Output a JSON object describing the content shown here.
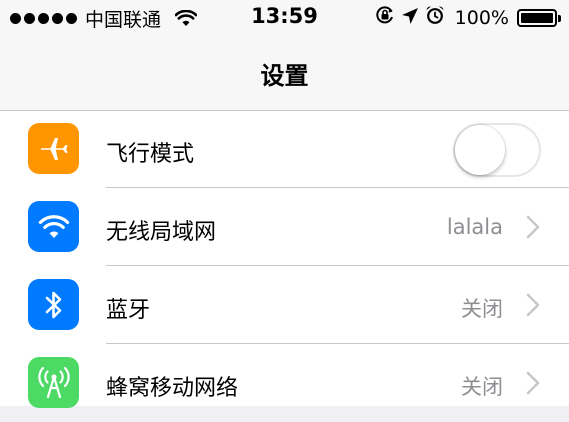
{
  "status_bar": {
    "carrier": "中国联通",
    "time": "13:59",
    "battery_percent": "100%",
    "icons": [
      "signal-dots",
      "wifi-icon",
      "orientation-lock-icon",
      "location-arrow-icon",
      "alarm-clock-icon",
      "battery-icon"
    ]
  },
  "nav": {
    "title": "设置"
  },
  "settings": {
    "items": [
      {
        "label": "飞行模式",
        "icon": "airplane-icon",
        "color": "#ff9500",
        "control": "toggle",
        "on": false
      },
      {
        "label": "无线局域网",
        "icon": "wifi-icon",
        "color": "#007aff",
        "value": "lalala"
      },
      {
        "label": "蓝牙",
        "icon": "bluetooth-icon",
        "color": "#007aff",
        "value": "关闭"
      },
      {
        "label": "蜂窝移动网络",
        "icon": "cellular-antenna-icon",
        "color": "#4cd964",
        "value": "关闭"
      }
    ]
  },
  "colors": {
    "background": "#efeff4",
    "separator": "#c8c7cc",
    "secondary_text": "#8e8e93"
  }
}
